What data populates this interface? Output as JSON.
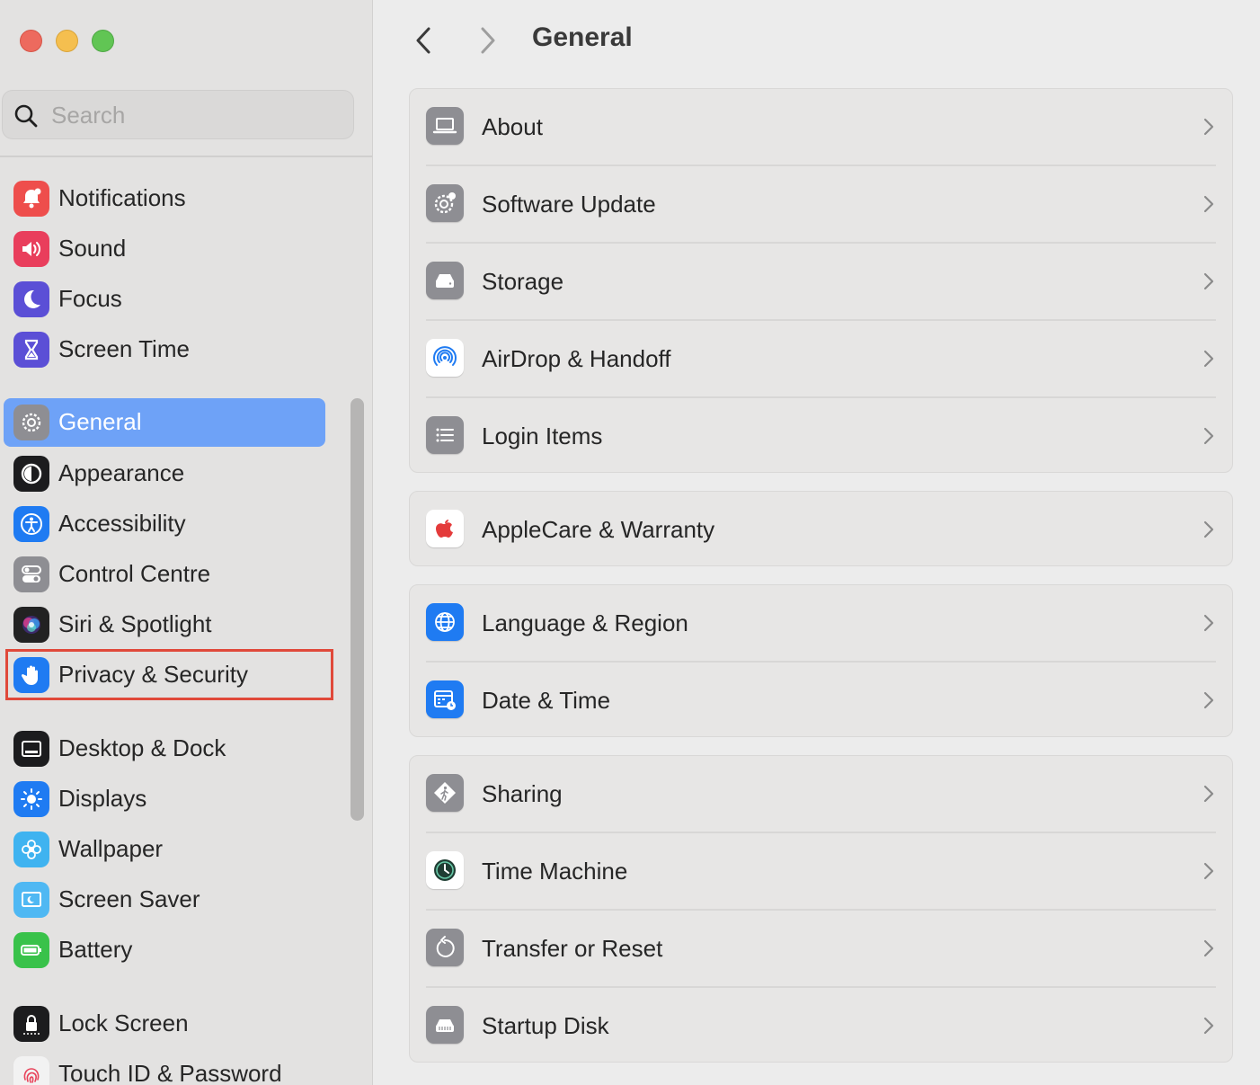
{
  "window": {
    "traffic_lights": [
      "close",
      "minimize",
      "zoom"
    ]
  },
  "search": {
    "placeholder": "Search"
  },
  "sidebar": {
    "groups": [
      [
        {
          "label": "Notifications",
          "icon": "bell-icon",
          "color": "#ee4e4c"
        },
        {
          "label": "Sound",
          "icon": "speaker-icon",
          "color": "#e93e5c"
        },
        {
          "label": "Focus",
          "icon": "moon-icon",
          "color": "#5b4fd6"
        },
        {
          "label": "Screen Time",
          "icon": "hourglass-icon",
          "color": "#5b4fd6"
        }
      ],
      [
        {
          "label": "General",
          "icon": "gear-icon",
          "color": "#8e8e93",
          "selected": true
        },
        {
          "label": "Appearance",
          "icon": "appearance-icon",
          "color": "#1c1c1e"
        },
        {
          "label": "Accessibility",
          "icon": "accessibility-icon",
          "color": "#1f7bf2"
        },
        {
          "label": "Control Centre",
          "icon": "toggles-icon",
          "color": "#8e8e93"
        },
        {
          "label": "Siri & Spotlight",
          "icon": "siri-icon",
          "color": "#222222"
        },
        {
          "label": "Privacy & Security",
          "icon": "hand-icon",
          "color": "#1f7bf2",
          "highlighted": true
        }
      ],
      [
        {
          "label": "Desktop & Dock",
          "icon": "dock-icon",
          "color": "#1c1c1e"
        },
        {
          "label": "Displays",
          "icon": "sun-icon",
          "color": "#1f7bf2"
        },
        {
          "label": "Wallpaper",
          "icon": "flower-icon",
          "color": "#3fb3f0"
        },
        {
          "label": "Screen Saver",
          "icon": "screensaver-icon",
          "color": "#4fb8f3"
        },
        {
          "label": "Battery",
          "icon": "battery-icon",
          "color": "#39c24a"
        }
      ],
      [
        {
          "label": "Lock Screen",
          "icon": "lock-icon",
          "color": "#1c1c1e"
        },
        {
          "label": "Touch ID & Password",
          "icon": "fingerprint-icon",
          "color": "#f2f2f2"
        }
      ]
    ]
  },
  "main": {
    "title": "General",
    "groups": [
      [
        {
          "label": "About",
          "icon": "laptop-icon",
          "color": "#8e8e93"
        },
        {
          "label": "Software Update",
          "icon": "gear-badge-icon",
          "color": "#8e8e93"
        },
        {
          "label": "Storage",
          "icon": "drive-icon",
          "color": "#8e8e93"
        },
        {
          "label": "AirDrop & Handoff",
          "icon": "airdrop-icon",
          "color": "#ffffff"
        },
        {
          "label": "Login Items",
          "icon": "list-icon",
          "color": "#8e8e93"
        }
      ],
      [
        {
          "label": "AppleCare & Warranty",
          "icon": "apple-icon",
          "color": "#ffffff"
        }
      ],
      [
        {
          "label": "Language & Region",
          "icon": "globe-icon",
          "color": "#1f7bf2"
        },
        {
          "label": "Date & Time",
          "icon": "calendar-clock-icon",
          "color": "#1f7bf2"
        }
      ],
      [
        {
          "label": "Sharing",
          "icon": "sharing-icon",
          "color": "#8e8e93"
        },
        {
          "label": "Time Machine",
          "icon": "time-machine-icon",
          "color": "#ffffff"
        },
        {
          "label": "Transfer or Reset",
          "icon": "reset-icon",
          "color": "#8e8e93"
        },
        {
          "label": "Startup Disk",
          "icon": "disk-icon",
          "color": "#8e8e93"
        }
      ]
    ]
  }
}
